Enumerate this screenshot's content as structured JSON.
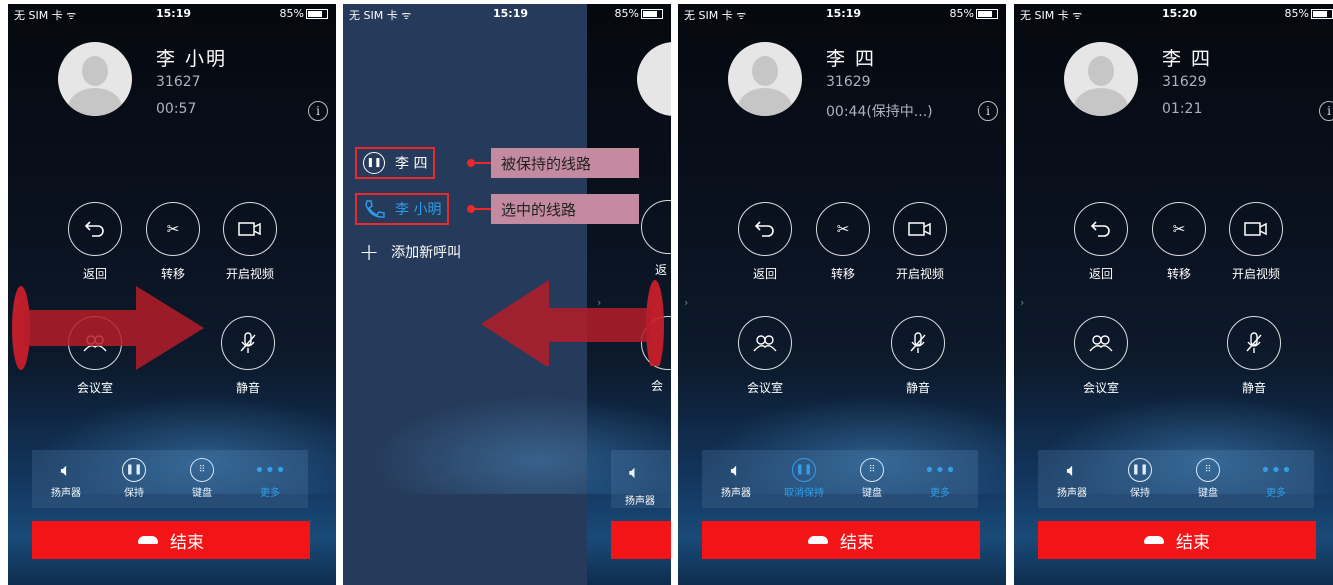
{
  "panels": [
    {
      "status": {
        "carrier": "无 SIM 卡 ᯤ",
        "time": "15:19",
        "battery": "85%"
      },
      "caller": {
        "name": "李 小明",
        "number": "31627",
        "duration": "00:57"
      },
      "buttons": {
        "back": "返回",
        "transfer": "转移",
        "video": "开启视频",
        "conference": "会议室",
        "mute": "静音"
      },
      "toolbar": {
        "speaker": "扬声器",
        "hold": "保持",
        "keypad": "键盘",
        "more": "更多"
      },
      "end": "结束"
    },
    {
      "status": {
        "carrier": "无 SIM 卡 ᯤ",
        "time": "15:19",
        "battery": "85%"
      },
      "lines": [
        {
          "name": "李 四",
          "callout": "被保持的线路",
          "state": "hold"
        },
        {
          "name": "李 小明",
          "callout": "选中的线路",
          "state": "selected"
        }
      ],
      "add_call": "添加新呼叫",
      "peek": {
        "back": "返",
        "conference": "会",
        "speaker": "扬声器"
      }
    },
    {
      "status": {
        "carrier": "无 SIM 卡 ᯤ",
        "time": "15:19",
        "battery": "85%"
      },
      "caller": {
        "name": "李 四",
        "number": "31629",
        "duration": "00:44(保持中...)"
      },
      "buttons": {
        "back": "返回",
        "transfer": "转移",
        "video": "开启视频",
        "conference": "会议室",
        "mute": "静音"
      },
      "toolbar": {
        "speaker": "扬声器",
        "hold": "取消保持",
        "keypad": "键盘",
        "more": "更多"
      },
      "end": "结束"
    },
    {
      "status": {
        "carrier": "无 SIM 卡 ᯤ",
        "time": "15:20",
        "battery": "85%"
      },
      "caller": {
        "name": "李 四",
        "number": "31629",
        "duration": "01:21"
      },
      "buttons": {
        "back": "返回",
        "transfer": "转移",
        "video": "开启视频",
        "conference": "会议室",
        "mute": "静音"
      },
      "toolbar": {
        "speaker": "扬声器",
        "hold": "保持",
        "keypad": "键盘",
        "more": "更多"
      },
      "end": "结束"
    }
  ],
  "colors": {
    "end_red": "#f21416",
    "callout_pink": "#c48ba0",
    "highlight_blue": "#2a9ce8",
    "annotation_red": "#e82a2a"
  }
}
